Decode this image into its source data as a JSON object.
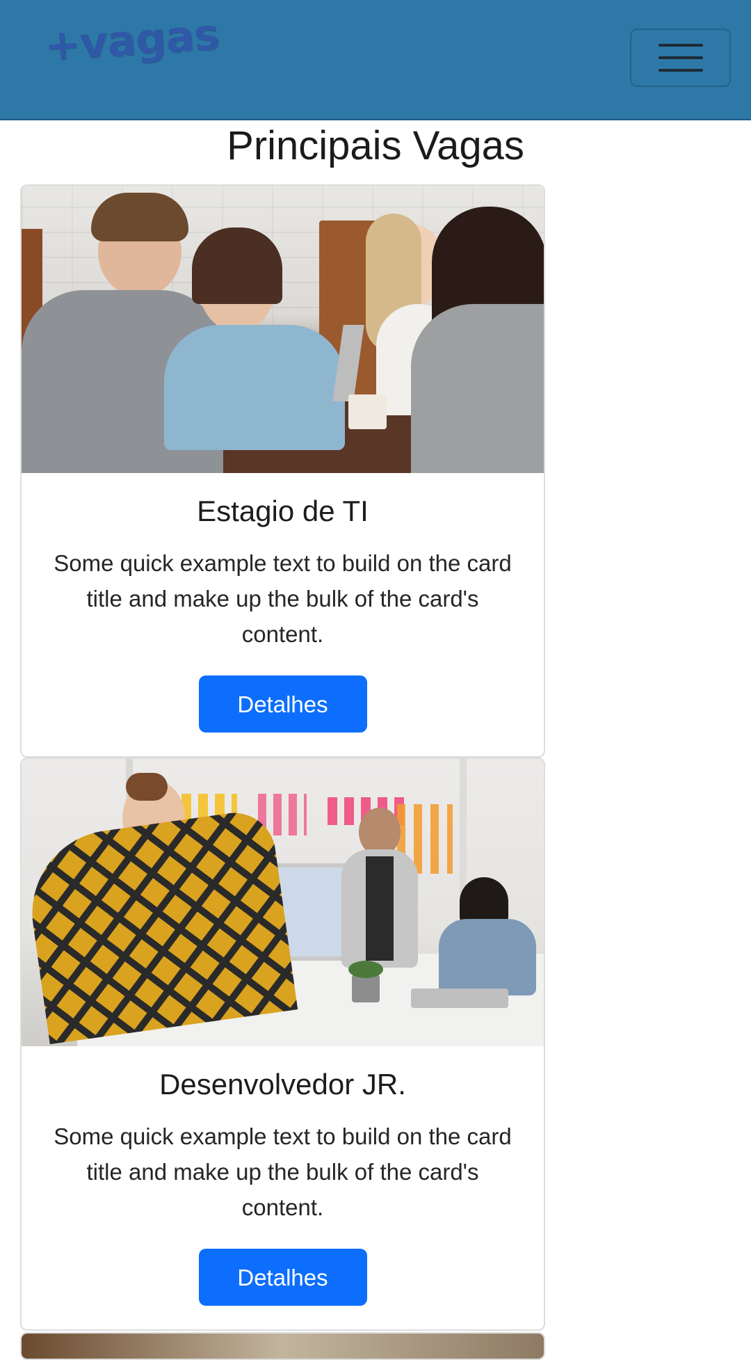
{
  "navbar": {
    "brand": "+vagas",
    "menu_icon": "hamburger-menu-icon"
  },
  "page": {
    "title": "Principais Vagas"
  },
  "cards": [
    {
      "title": "Estagio de TI",
      "text": "Some quick example text to build on the card title and make up the bulk of the card's content.",
      "button": "Detalhes",
      "image": "team-meeting-photo"
    },
    {
      "title": "Desenvolvedor JR.",
      "text": "Some quick example text to build on the card title and make up the bulk of the card's content.",
      "button": "Detalhes",
      "image": "office-presentation-photo"
    }
  ],
  "colors": {
    "navbar": "#2e78a7",
    "brand": "#2f58a6",
    "button": "#0d6efd"
  }
}
